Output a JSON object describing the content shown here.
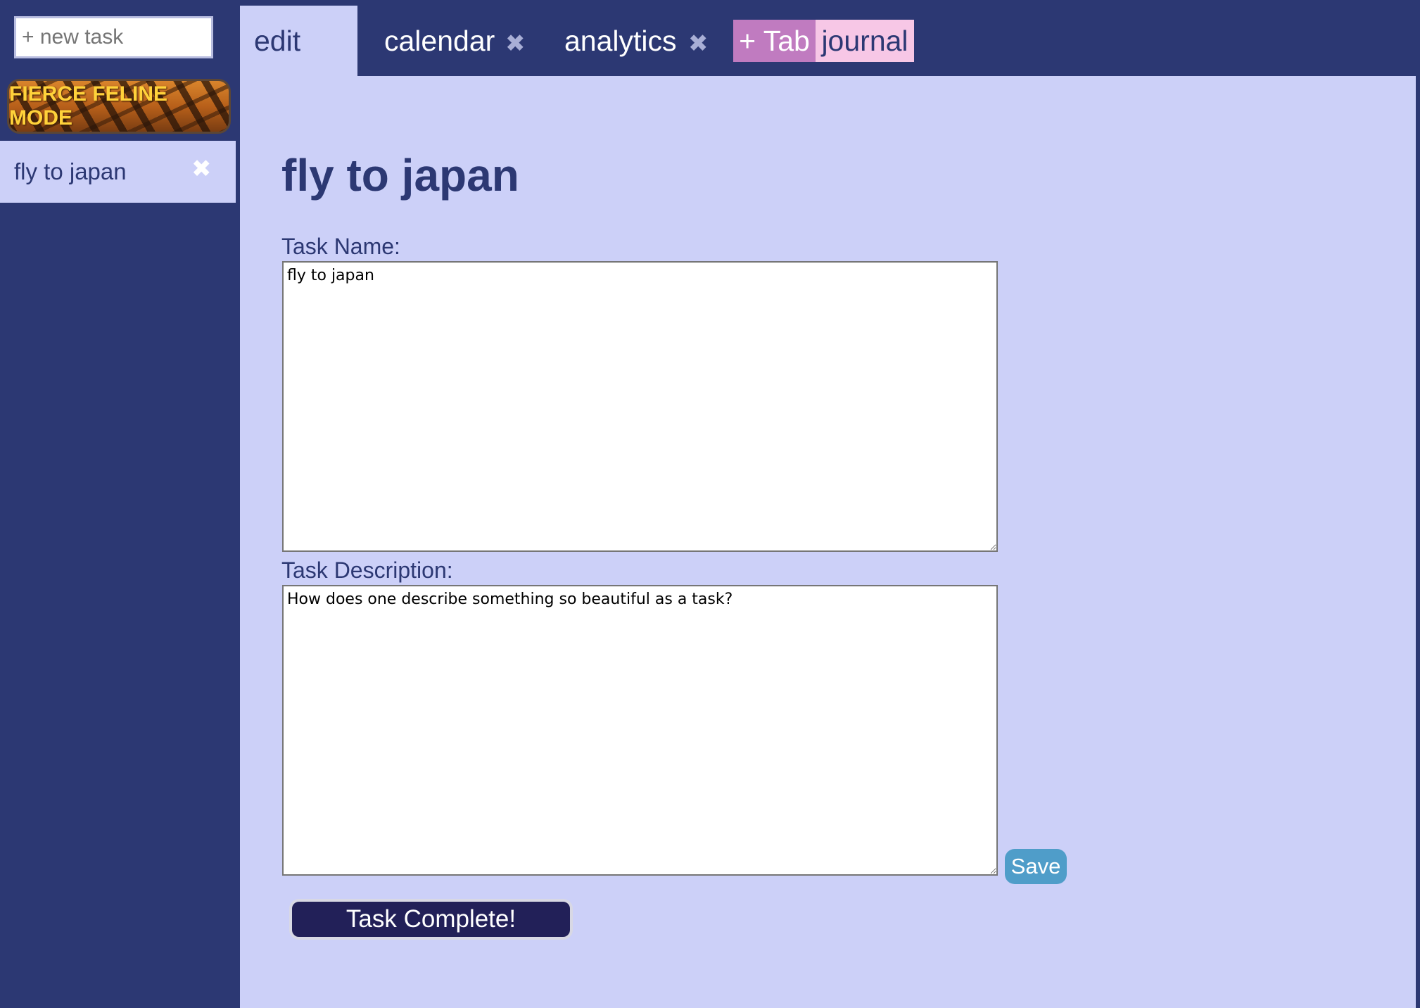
{
  "sidebar": {
    "new_task_placeholder": "+ new task",
    "mode_button_label": "FIERCE FELINE MODE",
    "tasks": [
      {
        "label": "fly to japan",
        "close_glyph": "✖"
      }
    ]
  },
  "tabs": [
    {
      "label": "edit",
      "active": true
    },
    {
      "label": "calendar",
      "close_glyph": "✖"
    },
    {
      "label": "analytics",
      "close_glyph": "✖"
    },
    {
      "label": "+ Tab"
    },
    {
      "label": "journal"
    }
  ],
  "editor": {
    "title": "fly to japan",
    "task_name_label": "Task Name:",
    "task_name_value": "fly to japan",
    "task_description_label": "Task Description:",
    "task_description_value": "How does one describe something so beautiful as a task?",
    "save_label": "Save",
    "complete_label": "Task Complete!"
  },
  "colors": {
    "background": "#2c3873",
    "panel": "#ccd0f8",
    "add_tab": "#c07bc0",
    "journal_tab": "#f7c7e6",
    "save_button": "#4f9dc9",
    "complete_button": "#222058",
    "mode_text": "#ffd23a"
  }
}
